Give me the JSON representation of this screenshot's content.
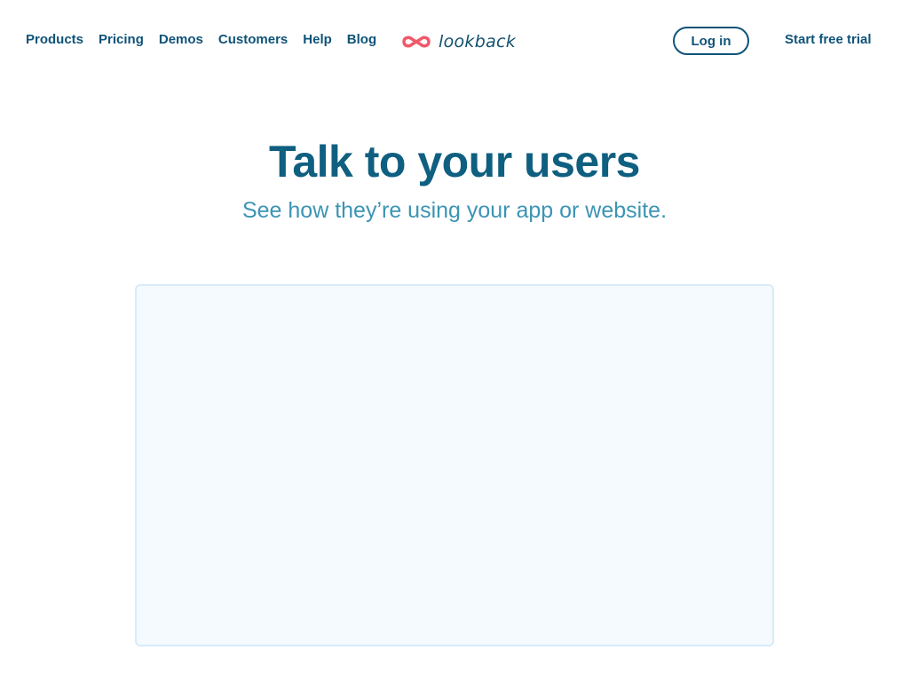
{
  "nav": {
    "links": [
      {
        "label": "Products"
      },
      {
        "label": "Pricing"
      },
      {
        "label": "Demos"
      },
      {
        "label": "Customers"
      },
      {
        "label": "Help"
      },
      {
        "label": "Blog"
      }
    ],
    "logo": {
      "icon": "infinity-loop-icon",
      "text": "lookback",
      "icon_color": "#f0596a"
    },
    "login_label": "Log in",
    "trial_label": "Start free trial"
  },
  "hero": {
    "title": "Talk to your users",
    "subtitle": "See how they’re using your app or website."
  },
  "colors": {
    "brand_dark": "#0f5378",
    "title": "#0f5f80",
    "subtitle": "#3c94b4",
    "logo_red": "#f0596a",
    "panel_bg": "#f5faff",
    "panel_border": "#d6ecfa"
  }
}
